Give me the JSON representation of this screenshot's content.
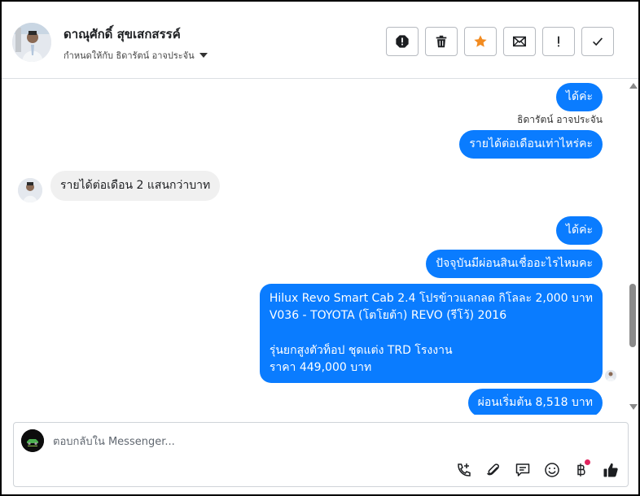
{
  "header": {
    "contact_name": "ดาณุศักดิ์ สุขเสกสรรค์",
    "assign_label": "กำหนดให้กับ ธิดารัตน์ อาจประจัน",
    "actions": [
      {
        "name": "spam-button",
        "icon": "alert-octagon-icon"
      },
      {
        "name": "delete-button",
        "icon": "trash-icon"
      },
      {
        "name": "star-button",
        "icon": "star-icon"
      },
      {
        "name": "mark-unread-button",
        "icon": "envelope-icon"
      },
      {
        "name": "follow-up-button",
        "icon": "exclamation-icon"
      },
      {
        "name": "done-button",
        "icon": "check-icon"
      }
    ],
    "accent_star": "#f28b20"
  },
  "thread": {
    "messages": [
      {
        "dir": "out",
        "text": "ได้ค่ะ"
      },
      {
        "dir": "label",
        "text": "ธิดารัตน์ อาจประจัน"
      },
      {
        "dir": "out",
        "text": "รายได้ต่อเดือนเท่าไหร่คะ"
      },
      {
        "dir": "in",
        "text": "รายได้ต่อเดือน 2 แสนกว่าบาท"
      },
      {
        "dir": "out",
        "text": "ได้ค่ะ"
      },
      {
        "dir": "out",
        "text": "ปัจจุบันมีผ่อนสินเชื่ออะไรไหมคะ"
      },
      {
        "dir": "out",
        "lines": [
          "Hilux Revo Smart Cab 2.4 โปรข้าวแลกลด กิโลละ 2,000 บาท",
          "V036 - TOYOTA (โตโยต้า) REVO (รีโว้) 2016",
          "",
          " รุ่นยกสูงตัวท็อป ชุดแต่ง TRD โรงงาน",
          "ราคา 449,000 บาท"
        ]
      },
      {
        "dir": "out",
        "text": "ผ่อนเริ่มต้น 8,518 บาท"
      }
    ],
    "outgoing_color": "#0a7cff",
    "incoming_color": "#f0f0f0"
  },
  "composer": {
    "placeholder": "ตอบกลับใน Messenger...",
    "value": "",
    "tools": [
      "phone-add-icon",
      "paperclip-icon",
      "chat-bubble-icon",
      "emoji-icon",
      "baht-icon",
      "thumbs-up-icon"
    ]
  }
}
